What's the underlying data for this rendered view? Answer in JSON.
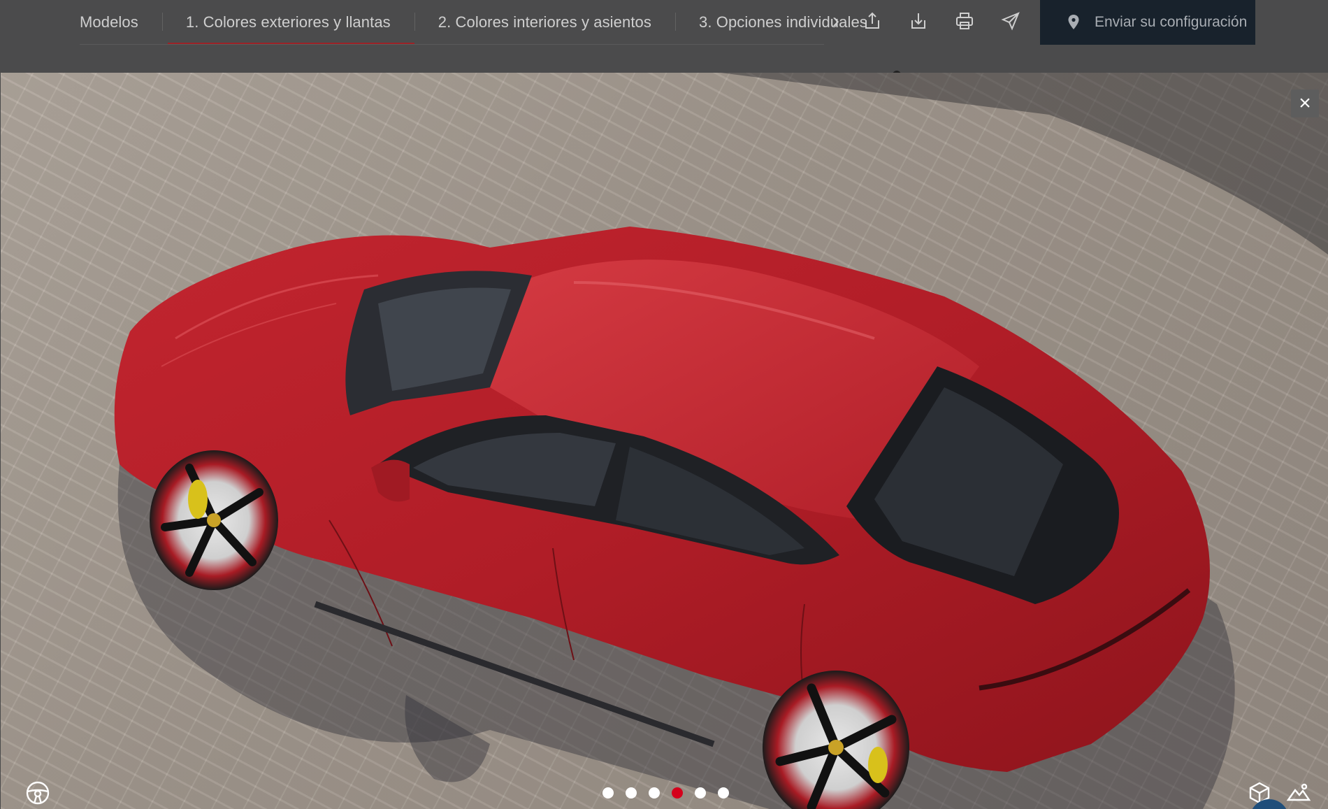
{
  "nav": {
    "tabs": [
      {
        "label": "Modelos"
      },
      {
        "label": "1. Colores exteriores y llantas",
        "active": true
      },
      {
        "label": "2. Colores interiores y asientos"
      },
      {
        "label": "3. Opciones individuales"
      }
    ],
    "next_icon": "chevron-right-icon",
    "tools": [
      "share-icon",
      "download-icon",
      "print-icon",
      "send-icon"
    ],
    "send_config_label": "Enviar su configuración",
    "send_config_icon": "map-pin-icon"
  },
  "viewer": {
    "close_icon": "close-icon",
    "close_label": "×",
    "slides": {
      "count": 6,
      "active_index": 3
    },
    "accent_color": "#d5001c",
    "left_corner_icon": "steering-wheel-icon",
    "right_corner_icons": [
      "3d-view-icon",
      "landscape-view-icon"
    ]
  },
  "colors": {
    "topbar": "#4b4b4c",
    "send_button": "#18222c",
    "active_tab_underline": "#9c2227",
    "car_body": "#b5202a"
  }
}
